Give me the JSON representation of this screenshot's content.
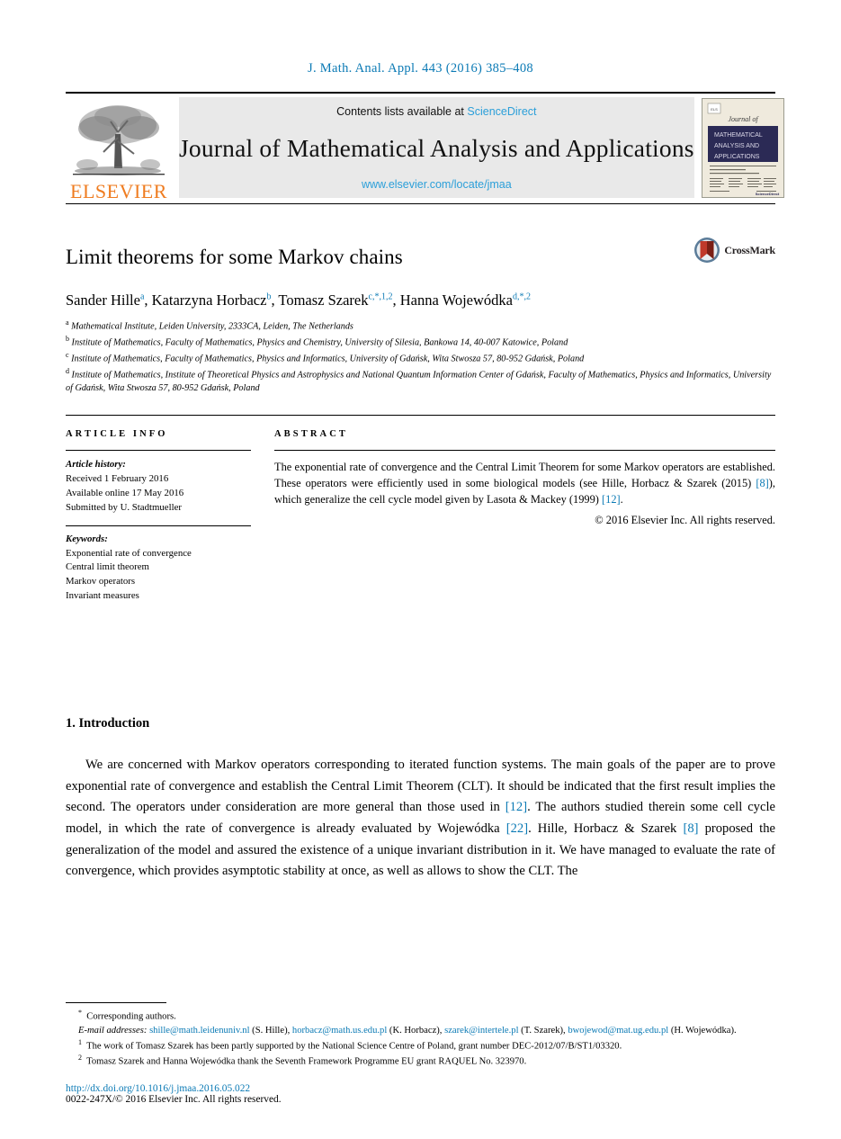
{
  "running_head": "J. Math. Anal. Appl. 443 (2016) 385–408",
  "masthead": {
    "publisher_name": "ELSEVIER",
    "contents_prefix": "Contents lists available at",
    "contents_link": "ScienceDirect",
    "journal_name": "Journal of Mathematical Analysis and Applications",
    "journal_url": "www.elsevier.com/locate/jmaa",
    "cover": {
      "kicker": "Journal of",
      "band_line1": "MATHEMATICAL",
      "band_line2": "ANALYSIS AND",
      "band_line3": "APPLICATIONS",
      "publisher_mark": "ScienceDirect"
    },
    "colors": {
      "link_blue": "#2b9fd9",
      "elsevier_orange": "#ef7c20",
      "box_grey": "#e9e9e9",
      "cover_band": "#2b2a55"
    }
  },
  "article": {
    "title": "Limit theorems for some Markov chains",
    "crossmark_label": "CrossMark",
    "authors_html": "Sander Hille<sup>a</sup>, Katarzyna Horbacz<sup>b</sup>, Tomasz Szarek<sup>c,*,1,2</sup>, Hanna Wojewódka<sup>d,*,2</sup>",
    "affiliations": [
      "Mathematical Institute, Leiden University, 2333CA, Leiden, The Netherlands",
      "Institute of Mathematics, Faculty of Mathematics, Physics and Chemistry, University of Silesia, Bankowa 14, 40-007 Katowice, Poland",
      "Institute of Mathematics, Faculty of Mathematics, Physics and Informatics, University of Gdańsk, Wita Stwosza 57, 80-952 Gdańsk, Poland",
      "Institute of Mathematics, Institute of Theoretical Physics and Astrophysics and National Quantum Information Center of Gdańsk, Faculty of Mathematics, Physics and Informatics, University of Gdańsk, Wita Stwosza 57, 80-952 Gdańsk, Poland"
    ],
    "affiliation_markers": [
      "a",
      "b",
      "c",
      "d"
    ]
  },
  "info": {
    "label": "ARTICLE INFO",
    "history_heading": "Article history:",
    "history": [
      "Received 1 February 2016",
      "Available online 17 May 2016",
      "Submitted by U. Stadtmueller"
    ],
    "keywords_heading": "Keywords:",
    "keywords": [
      "Exponential rate of convergence",
      "Central limit theorem",
      "Markov operators",
      "Invariant measures"
    ]
  },
  "abstract": {
    "label": "ABSTRACT",
    "text_html": "The exponential rate of convergence and the Central Limit Theorem for some Markov operators are established. These operators were efficiently used in some biological models (see Hille, Horbacz &amp; Szarek (2015) <span class=\"ref\">[8]</span>), which generalize the cell cycle model given by Lasota &amp; Mackey (1999) <span class=\"ref\">[12]</span>.",
    "copyright": "© 2016 Elsevier Inc. All rights reserved."
  },
  "body": {
    "section_number_title": "1. Introduction",
    "paragraph_html": "We are concerned with Markov operators corresponding to iterated function systems. The main goals of the paper are to prove exponential rate of convergence and establish the Central Limit Theorem (CLT). It should be indicated that the first result implies the second. The operators under consideration are more general than those used in <span class=\"ref\">[12]</span>. The authors studied therein some cell cycle model, in which the rate of convergence is already evaluated by Wojewódka <span class=\"ref\">[22]</span>. Hille, Horbacz &amp; Szarek <span class=\"ref\">[8]</span> proposed the generalization of the model and assured the existence of a unique invariant distribution in it. We have managed to evaluate the rate of convergence, which provides asymptotic stability at once, as well as allows to show the CLT. The"
  },
  "footnotes": {
    "corresponding_html": "<sup>*</sup>&nbsp; Corresponding authors.",
    "emails_html": "<em>E-mail addresses:</em> <span class=\"ref\">shille@math.leidenuniv.nl</span> (S. Hille), <span class=\"ref\">horbacz@math.us.edu.pl</span> (K. Horbacz), <span class=\"ref\">szarek@intertele.pl</span> (T. Szarek), <span class=\"ref\">bwojewod@mat.ug.edu.pl</span> (H. Wojewódka).",
    "note1_html": "<sup>1</sup>&nbsp; The work of Tomasz Szarek has been partly supported by the National Science Centre of Poland, grant number DEC-2012/07/B/ST1/03320.",
    "note2_html": "<sup>2</sup>&nbsp; Tomasz Szarek and Hanna Wojewódka thank the Seventh Framework Programme EU grant RAQUEL No. 323970.",
    "doi": "http://dx.doi.org/10.1016/j.jmaa.2016.05.022",
    "issn_line": "0022-247X/© 2016 Elsevier Inc. All rights reserved."
  }
}
